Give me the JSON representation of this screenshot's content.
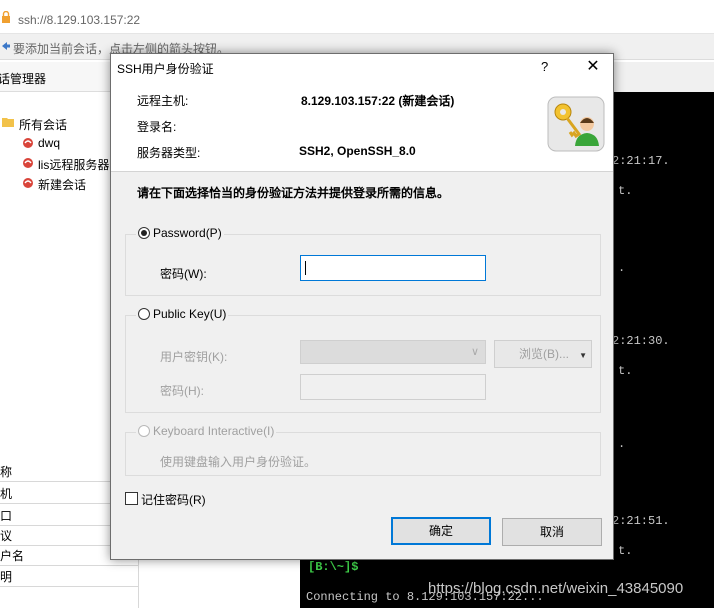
{
  "background": {
    "address": "ssh://8.129.103.157:22",
    "hint": "要添加当前会话，点击左侧的箭头按钮。",
    "manager_title": "话管理器",
    "tree": [
      {
        "label": "所有会话",
        "icon": "folder-icon"
      },
      {
        "label": "dwq",
        "icon": "session-icon"
      },
      {
        "label": "lis远程服务器",
        "icon": "session-icon"
      },
      {
        "label": "新建会话",
        "icon": "session-icon"
      }
    ],
    "props": [
      "称",
      "机",
      "口",
      "议",
      "户名",
      "明"
    ],
    "terminal": {
      "lines": [
        {
          "text": "2:21:17.",
          "row": "a"
        },
        {
          "text": "t.",
          "row": "b"
        },
        {
          "text": ".",
          "row": "c"
        },
        {
          "text": "2:21:30.",
          "row": "d"
        },
        {
          "text": "t.",
          "row": "e"
        },
        {
          "text": ".",
          "row": "f"
        },
        {
          "text": "2:21:51.",
          "row": "g"
        },
        {
          "text": "t.",
          "row": "h"
        }
      ],
      "prompt": "[B:\\~]$",
      "connecting": "Connecting to 8.129.103.157:22..."
    },
    "watermark": "https://blog.csdn.net/weixin_43845090"
  },
  "dialog": {
    "title": "SSH用户身份验证",
    "help": "?",
    "close": "✕",
    "remote_host_label": "远程主机:",
    "remote_host_value": "8.129.103.157:22 (新建会话)",
    "login_name_label": "登录名:",
    "login_name_value": "",
    "server_type_label": "服务器类型:",
    "server_type_value": "SSH2, OpenSSH_8.0",
    "instruction": "请在下面选择恰当的身份验证方法并提供登录所需的信息。",
    "password_option": "Password(P)",
    "password_label": "密码(W):",
    "password_value": "",
    "publickey_option": "Public Key(U)",
    "user_key_label": "用户密钥(K):",
    "browse_button": "浏览(B)...",
    "passphrase_label": "密码(H):",
    "keyboard_option": "Keyboard Interactive(I)",
    "keyboard_desc": "使用键盘输入用户身份验证。",
    "remember_label": "记住密码(R)",
    "ok_button": "确定",
    "cancel_button": "取消"
  }
}
